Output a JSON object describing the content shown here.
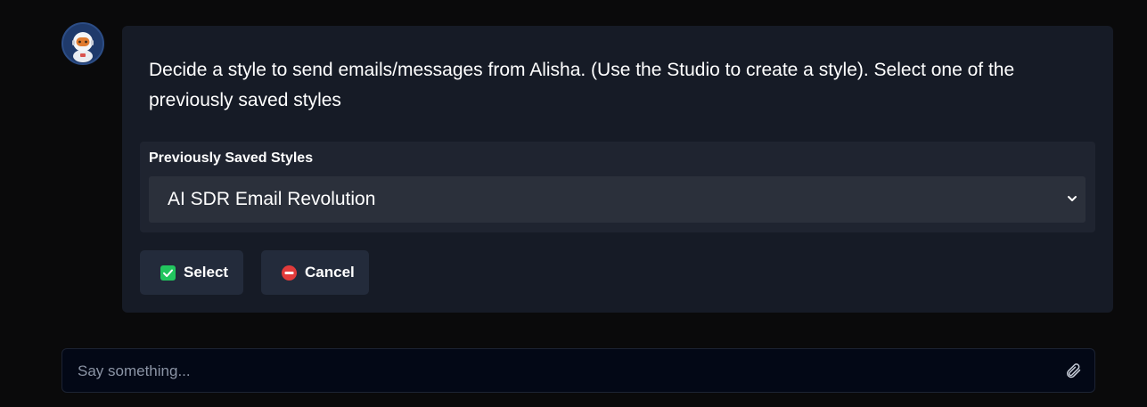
{
  "message": {
    "text": "Decide a style to send emails/messages from Alisha. (Use the Studio to create a style). Select one of the previously saved styles"
  },
  "styles_select": {
    "label": "Previously Saved Styles",
    "selected_value": "AI SDR Email Revolution"
  },
  "actions": {
    "select_label": "Select",
    "cancel_label": "Cancel"
  },
  "composer": {
    "placeholder": "Say something..."
  },
  "icons": {
    "avatar": "astronaut-avatar",
    "select_icon": "check-square-icon",
    "cancel_icon": "no-entry-icon",
    "dropdown": "chevron-down-icon",
    "attach": "paperclip-icon"
  },
  "colors": {
    "background": "#0a0a0b",
    "card": "#161b26",
    "select_panel": "#1f2430",
    "select_box": "#2b303b",
    "button": "#232b3b",
    "check_green": "#22c55e",
    "cancel_red": "#e23b3b",
    "input_bg": "#030816"
  }
}
